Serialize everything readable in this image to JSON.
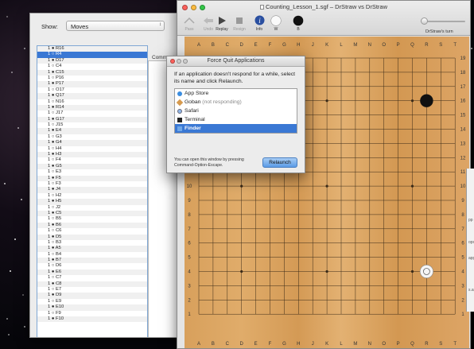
{
  "moves_window": {
    "show_label": "Show:",
    "show_value": "Moves",
    "comments_label": "Comments",
    "moves": [
      "1 ● R16",
      "1 ○ R4",
      "1 ● D17",
      "1 ○ C4",
      "1 ● C15",
      "1 ○ P16",
      "1 ● P17",
      "1 ○ O17",
      "1 ● Q17",
      "1 ○ N16",
      "1 ● R14",
      "1 ○ J17",
      "1 ● G17",
      "1 ○ J15",
      "1 ● E4",
      "1 ○ G3",
      "1 ● G4",
      "1 ○ H4",
      "1 ● H3",
      "1 ○ F4",
      "1 ● G5",
      "1 ○ E3",
      "1 ● F5",
      "1 ○ F3",
      "1 ● J4",
      "1 ○ H2",
      "1 ● H5",
      "1 ○ J2",
      "1 ● C5",
      "1 ○ B5",
      "1 ● B6",
      "1 ○ C6",
      "1 ● D5",
      "1 ○ B3",
      "1 ● A5",
      "1 ○ B4",
      "1 ● B7",
      "1 ○ D6",
      "1 ● E6",
      "1 ○ C7",
      "1 ● C8",
      "1 ○ E7",
      "1 ● D9",
      "1 ○ E9",
      "1 ● E10",
      "1 ○ F9",
      "1 ● F10"
    ],
    "selected_index": 1
  },
  "goban_window": {
    "title": "Counting_Lesson_1.sgf – DrStraw vs DrStraw",
    "toolbar": [
      {
        "label": "Pass",
        "icon": "pass-icon",
        "enabled": false
      },
      {
        "label": "Undo",
        "icon": "undo-icon",
        "enabled": false
      },
      {
        "label": "Replay",
        "icon": "replay-icon",
        "enabled": true
      },
      {
        "label": "Resign",
        "icon": "resign-icon",
        "enabled": false
      },
      {
        "label": "Info",
        "icon": "info-icon",
        "enabled": true
      },
      {
        "label": "W",
        "icon": "white-stone-icon",
        "enabled": true
      },
      {
        "label": "B",
        "icon": "black-stone-icon",
        "enabled": true
      }
    ],
    "turn_label": "DrStraw's turn",
    "board": {
      "size": 19,
      "columns": [
        "A",
        "B",
        "C",
        "D",
        "E",
        "F",
        "G",
        "H",
        "J",
        "K",
        "L",
        "M",
        "N",
        "O",
        "P",
        "Q",
        "R",
        "S",
        "T"
      ],
      "rows": [
        "19",
        "18",
        "17",
        "16",
        "15",
        "14",
        "13",
        "12",
        "11",
        "10",
        "9",
        "8",
        "7",
        "6",
        "5",
        "4",
        "3",
        "2",
        "1"
      ],
      "stones": [
        {
          "point": "R16",
          "color": "black"
        },
        {
          "point": "R4",
          "color": "white",
          "last_move": true
        }
      ]
    },
    "colors": {
      "board_wood": "#dba462",
      "grid": "#3a2a18"
    }
  },
  "force_quit": {
    "title": "Force Quit Applications",
    "message": "If an application doesn't respond for a while, select its name and click Relaunch.",
    "apps": [
      {
        "name": "App Store",
        "status": "",
        "icon": "app-store-icon"
      },
      {
        "name": "Goban",
        "status": "(not responding)",
        "icon": "goban-app-icon"
      },
      {
        "name": "Safari",
        "status": "",
        "icon": "safari-icon"
      },
      {
        "name": "Terminal",
        "status": "",
        "icon": "terminal-icon"
      },
      {
        "name": "Finder",
        "status": "",
        "icon": "finder-icon",
        "selected": true
      }
    ],
    "hint": "You can open this window by pressing Command-Option-Escape.",
    "button": "Relaunch"
  },
  "side_window": {
    "fragments": [
      "pp",
      "ops",
      "app",
      "s.app"
    ]
  }
}
